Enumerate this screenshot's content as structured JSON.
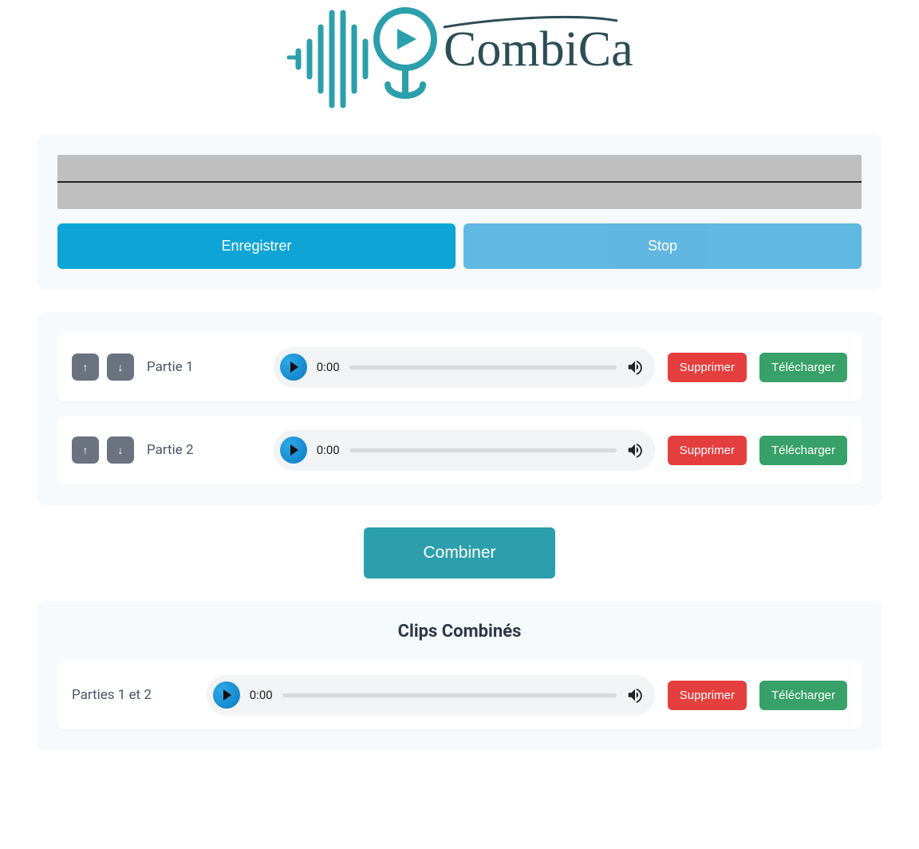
{
  "app_name": "CombiCast",
  "recorder": {
    "record_label": "Enregistrer",
    "stop_label": "Stop"
  },
  "clips": [
    {
      "label": "Partie 1",
      "time": "0:00",
      "delete_label": "Supprimer",
      "download_label": "Télécharger",
      "up_label": "↑",
      "down_label": "↓"
    },
    {
      "label": "Partie 2",
      "time": "0:00",
      "delete_label": "Supprimer",
      "download_label": "Télécharger",
      "up_label": "↑",
      "down_label": "↓"
    }
  ],
  "combine_label": "Combiner",
  "combined_section": {
    "title": "Clips Combinés",
    "clips": [
      {
        "label": "Parties 1 et 2",
        "time": "0:00",
        "delete_label": "Supprimer",
        "download_label": "Télécharger"
      }
    ]
  },
  "colors": {
    "accent": "#2c9fac",
    "record": "#0ea5d6",
    "stop": "#59b4e0",
    "delete": "#e53e3e",
    "download": "#38a169"
  }
}
